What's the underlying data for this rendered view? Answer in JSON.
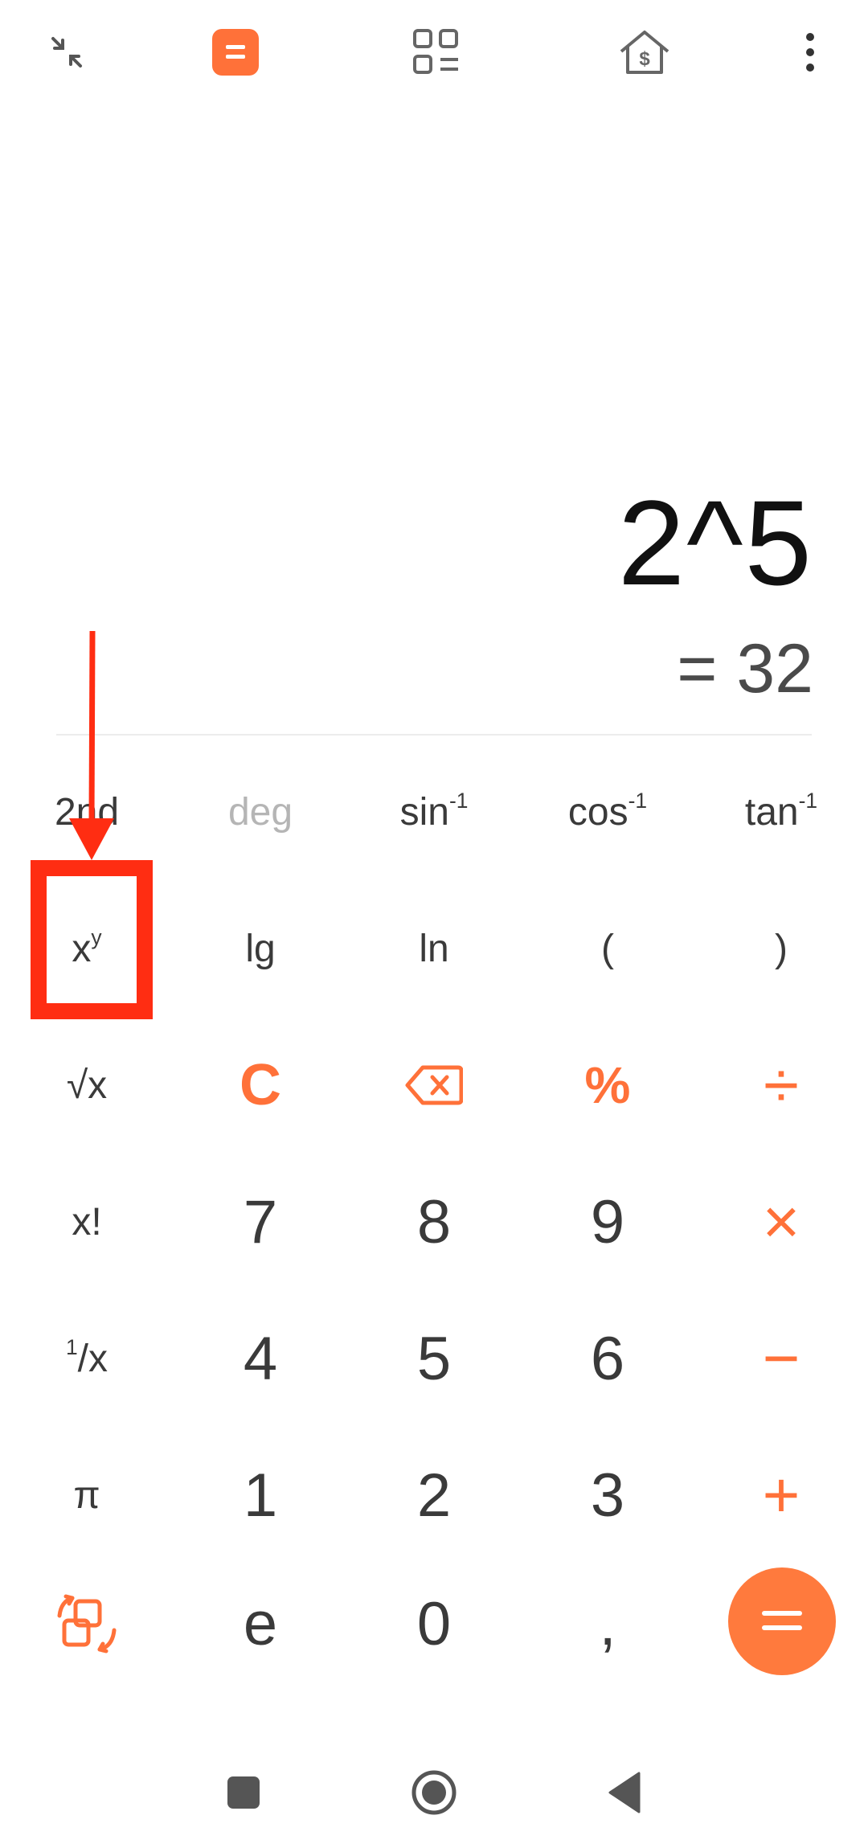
{
  "display": {
    "expression": "2^5",
    "result": "= 32"
  },
  "scientific_row1": {
    "second": "2nd",
    "deg": "deg",
    "asin_base": "sin",
    "acos_base": "cos",
    "atan_base": "tan",
    "inverse_sup": "-1"
  },
  "scientific_row2": {
    "power_base": "x",
    "power_sup": "y",
    "lg": "lg",
    "ln": "ln",
    "open_paren": "(",
    "close_paren": ")"
  },
  "side_keys": {
    "sqrt": "√x",
    "factorial": "x!",
    "reciprocal_num": "1",
    "reciprocal_den": "/x",
    "pi": "π",
    "e": "e"
  },
  "main_keys": {
    "clear": "C",
    "percent": "%",
    "divide": "÷",
    "multiply": "×",
    "minus": "−",
    "plus": "+",
    "comma": ",",
    "equals": "=",
    "digits": [
      "7",
      "8",
      "9",
      "4",
      "5",
      "6",
      "1",
      "2",
      "3",
      "0"
    ]
  },
  "icons": {
    "top": [
      "collapse-icon",
      "calculator-icon",
      "converter-grid-icon",
      "mortgage-house-icon",
      "more-vertical-icon"
    ],
    "nav": [
      "nav-square-icon",
      "nav-home-icon",
      "nav-back-icon"
    ]
  },
  "colors": {
    "accent": "#ff7139",
    "highlight": "#ff2d12",
    "text": "#3a3a3a"
  }
}
